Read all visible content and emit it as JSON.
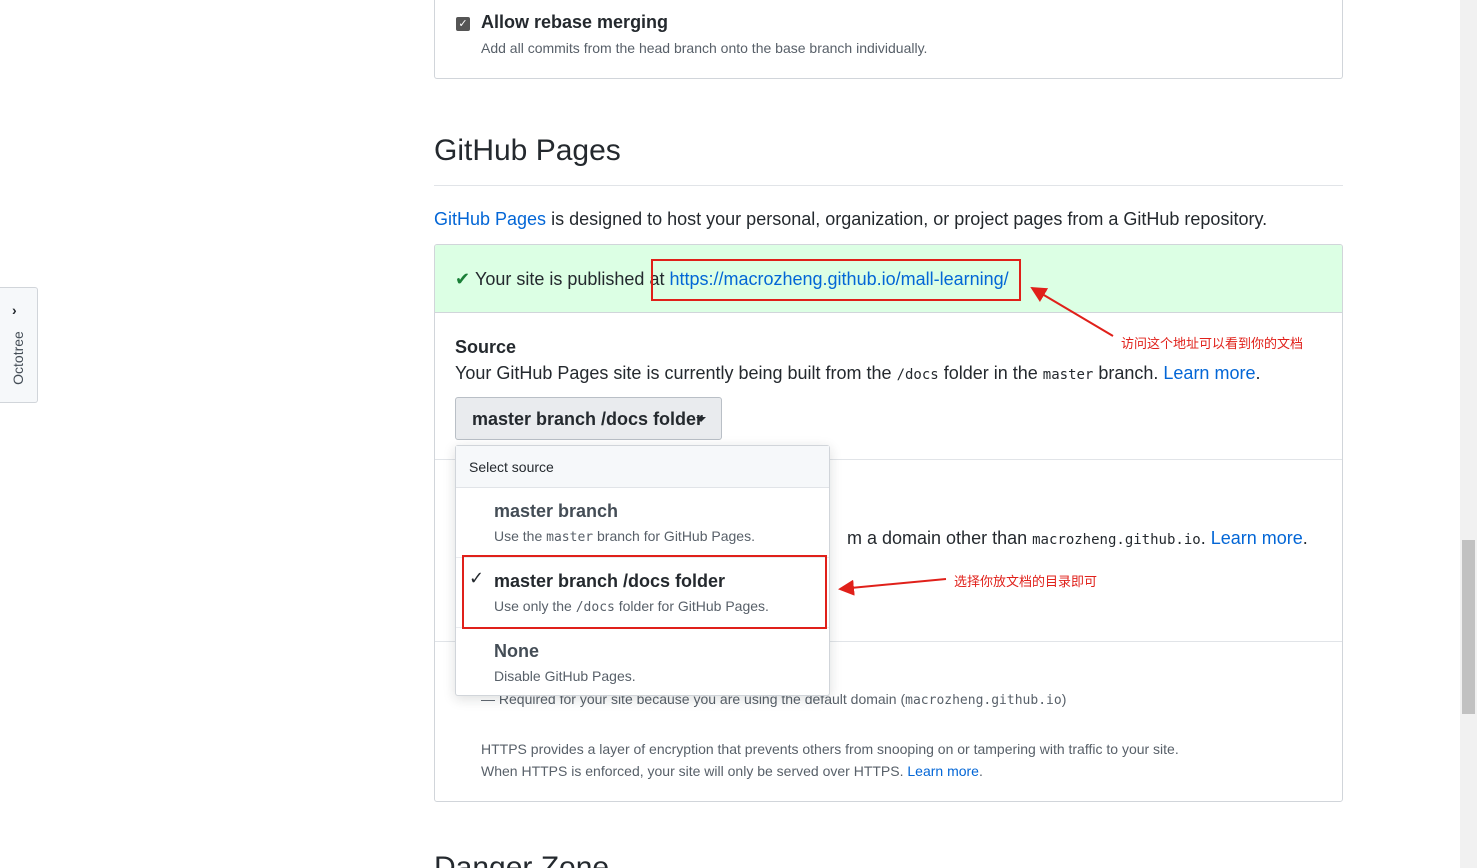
{
  "octotree": {
    "label": "Octotree",
    "chevron": "›"
  },
  "merge": {
    "rebase_label": "Allow rebase merging",
    "rebase_desc": "Add all commits from the head branch onto the base branch individually."
  },
  "pages": {
    "title": "GitHub Pages",
    "intro_link": "GitHub Pages",
    "intro_rest": " is designed to host your personal, organization, or project pages from a GitHub repository.",
    "published_prefix": "Your site is published at ",
    "published_url": "https://macrozheng.github.io/mall-learning/",
    "source_title": "Source",
    "source_desc_1": "Your GitHub Pages site is currently being built from the ",
    "source_desc_code1": "/docs",
    "source_desc_2": " folder in the ",
    "source_desc_code2": "master",
    "source_desc_3": " branch. ",
    "learn_more": "Learn more",
    "source_button": "master branch /docs folder",
    "domain_desc_1": "m a domain other than ",
    "domain_desc_code": "macrozheng.github.io",
    "domain_desc_2": ". ",
    "https_required_1": "— Required for your site because you are using the default domain (",
    "https_required_code": "macrozheng.github.io",
    "https_required_2": ")",
    "https_desc_1": "HTTPS provides a layer of encryption that prevents others from snooping on or tampering with traffic to your site.",
    "https_desc_2": "When HTTPS is enforced, your site will only be served over HTTPS. ",
    "period": ".",
    "next_title": "Danger Zone"
  },
  "dropdown": {
    "header": "Select source",
    "items": [
      {
        "name": "master branch",
        "desc_1": "Use the ",
        "desc_code": "master",
        "desc_2": " branch for GitHub Pages.",
        "selected": false
      },
      {
        "name": "master branch /docs folder",
        "desc_1": "Use only the ",
        "desc_code": "/docs",
        "desc_2": " folder for GitHub Pages.",
        "selected": true
      },
      {
        "name": "None",
        "desc_1": "Disable GitHub Pages.",
        "desc_code": "",
        "desc_2": "",
        "selected": false
      }
    ]
  },
  "annotations": {
    "note_url": "访问这个地址可以看到你的文档",
    "note_option": "选择你放文档的目录即可"
  },
  "colors": {
    "link": "#0366d6",
    "success_bg": "#dcffe4",
    "annotation": "#e0201a"
  }
}
